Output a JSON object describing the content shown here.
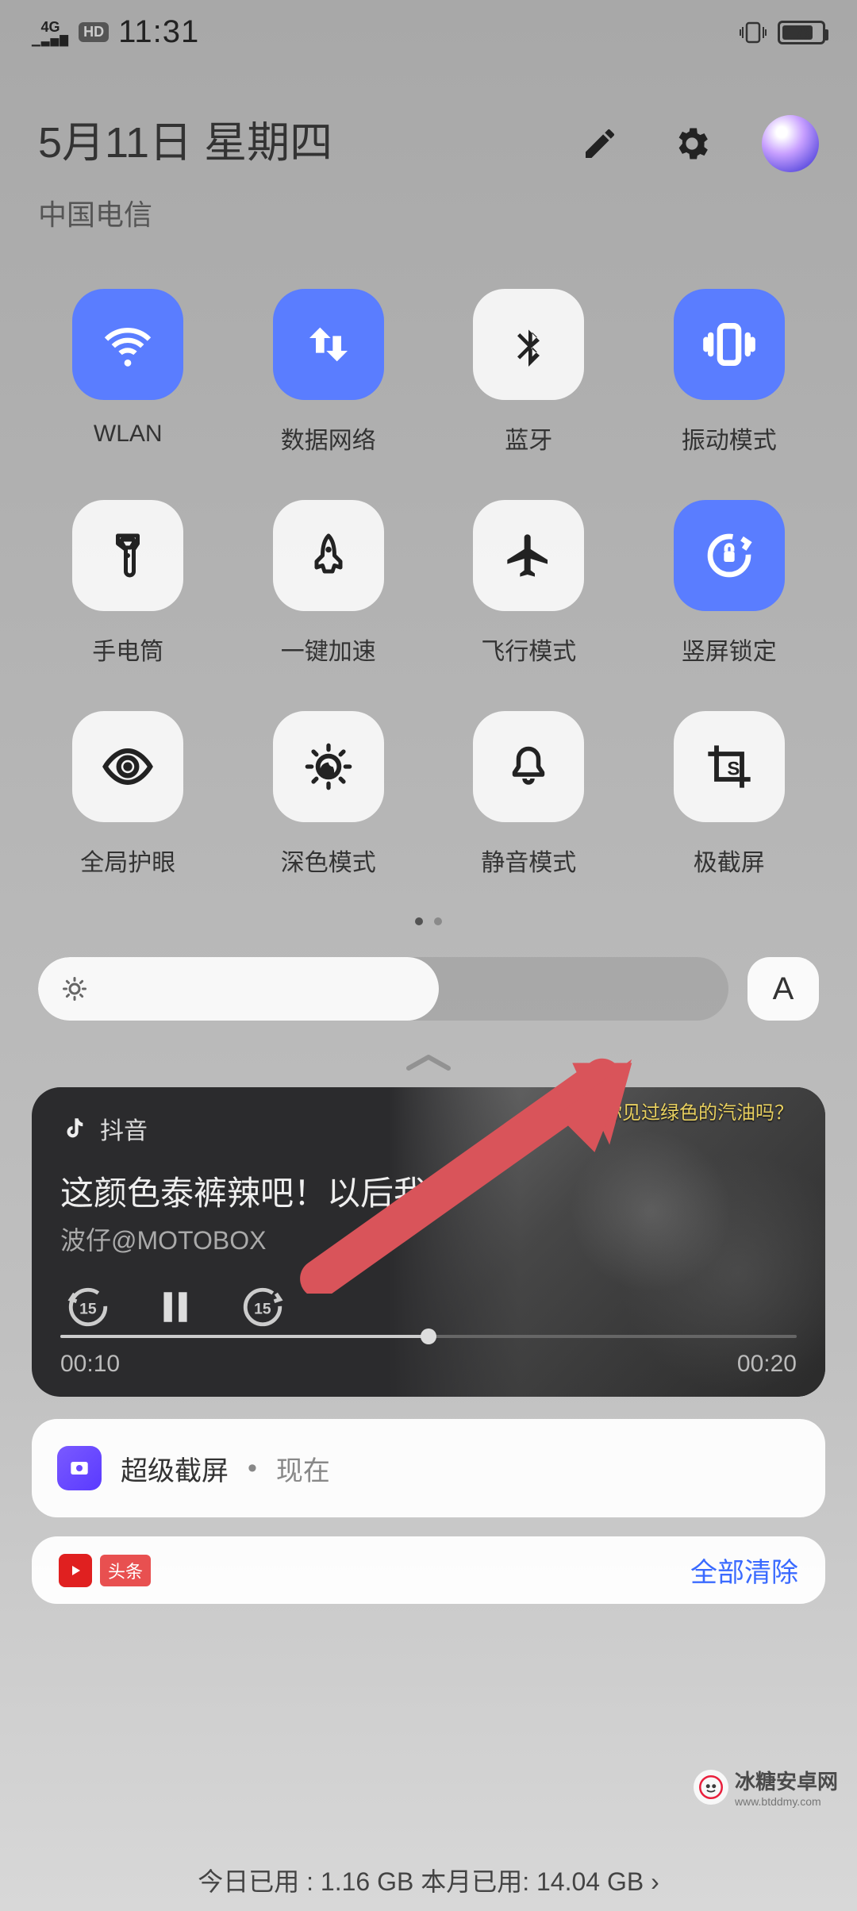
{
  "status": {
    "net": {
      "top": "4G",
      "bot": "⠿⠇"
    },
    "hd": "HD",
    "time": "11:31",
    "battery_pct": "79",
    "battery_fill_pct": 79
  },
  "header": {
    "date": "5月11日 星期四",
    "carrier": "中国电信"
  },
  "tiles": [
    {
      "id": "wifi",
      "label": "WLAN",
      "active": true,
      "icon": "wifi-icon"
    },
    {
      "id": "data",
      "label": "数据网络",
      "active": true,
      "icon": "data-icon"
    },
    {
      "id": "bt",
      "label": "蓝牙",
      "active": false,
      "icon": "bluetooth-icon"
    },
    {
      "id": "vibe",
      "label": "振动模式",
      "active": true,
      "icon": "vibrate-icon"
    },
    {
      "id": "torch",
      "label": "手电筒",
      "active": false,
      "icon": "torch-icon"
    },
    {
      "id": "boost",
      "label": "一键加速",
      "active": false,
      "icon": "rocket-icon"
    },
    {
      "id": "airplane",
      "label": "飞行模式",
      "active": false,
      "icon": "airplane-icon"
    },
    {
      "id": "lock",
      "label": "竖屏锁定",
      "active": true,
      "icon": "rotation-lock-icon"
    },
    {
      "id": "eye",
      "label": "全局护眼",
      "active": false,
      "icon": "eye-icon"
    },
    {
      "id": "dark",
      "label": "深色模式",
      "active": false,
      "icon": "dark-mode-icon"
    },
    {
      "id": "mute",
      "label": "静音模式",
      "active": false,
      "icon": "bell-icon"
    },
    {
      "id": "shot",
      "label": "极截屏",
      "active": false,
      "icon": "screenshot-icon"
    }
  ],
  "brightness": {
    "fill_pct": 58,
    "auto_label": "A"
  },
  "media": {
    "app": "抖音",
    "caption": "你见过绿色的汽油吗？",
    "title": "这颜色泰裤辣吧！以后我…",
    "subtitle": "波仔@MOTOBOX",
    "time_cur": "00:10",
    "time_total": "00:20",
    "progress_pct": 50
  },
  "notifications": {
    "app1_name": "超级截屏",
    "app1_time": "现在",
    "clear_all": "全部清除",
    "toutiao_badge": "头条"
  },
  "bottom": {
    "text": "今日已用 : 1.16 GB 本月已用: 14.04 GB ›"
  },
  "watermark": {
    "text": "冰糖安卓网",
    "sub": "www.btddmy.com"
  }
}
